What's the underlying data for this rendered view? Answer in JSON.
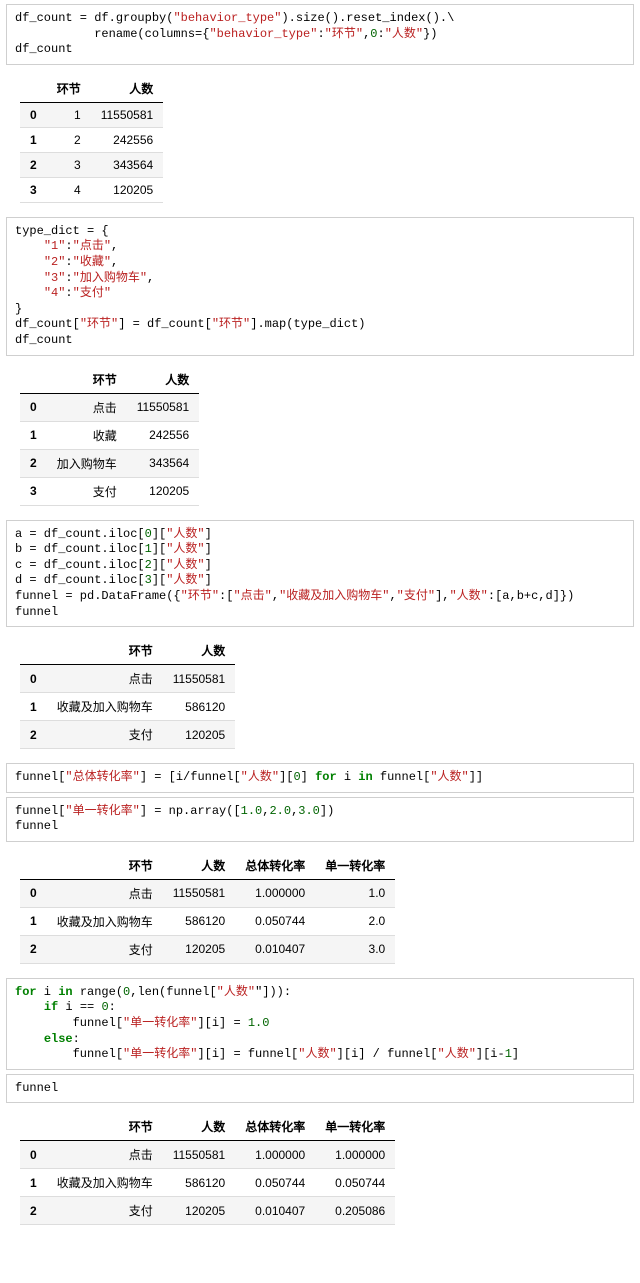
{
  "code1": {
    "l1a": "df_count = df.groupby(",
    "l1s": "\"behavior_type\"",
    "l1b": ").size().reset_index().\\",
    "l2a": "           rename(columns={",
    "l2s1": "\"behavior_type\"",
    "l2b": ":",
    "l2s2": "\"环节\"",
    "l2c": ",",
    "l2n": "0",
    "l2d": ":",
    "l2s3": "\"人数\"",
    "l2e": "})",
    "l3": "df_count"
  },
  "table1": {
    "headers": [
      "",
      "环节",
      "人数"
    ],
    "rows": [
      [
        "0",
        "1",
        "11550581"
      ],
      [
        "1",
        "2",
        "242556"
      ],
      [
        "2",
        "3",
        "343564"
      ],
      [
        "3",
        "4",
        "120205"
      ]
    ]
  },
  "code2": {
    "l1": "type_dict = {",
    "k1": "\"1\"",
    "v1": "\"点击\"",
    "k2": "\"2\"",
    "v2": "\"收藏\"",
    "k3": "\"3\"",
    "v3": "\"加入购物车\"",
    "k4": "\"4\"",
    "v4": "\"支付\"",
    "l6": "}",
    "l7a": "df_count[",
    "l7s1": "\"环节\"",
    "l7b": "] = df_count[",
    "l7s2": "\"环节\"",
    "l7c": "].map(type_dict)",
    "l8": "df_count"
  },
  "table2": {
    "headers": [
      "",
      "环节",
      "人数"
    ],
    "rows": [
      [
        "0",
        "点击",
        "11550581"
      ],
      [
        "1",
        "收藏",
        "242556"
      ],
      [
        "2",
        "加入购物车",
        "343564"
      ],
      [
        "3",
        "支付",
        "120205"
      ]
    ]
  },
  "code3": {
    "l1a": "a = df_count.iloc[",
    "n1": "0",
    "l1b": "][",
    "s1": "\"人数\"",
    "l1c": "]",
    "l2a": "b = df_count.iloc[",
    "n2": "1",
    "l2b": "][",
    "s2": "\"人数\"",
    "l2c": "]",
    "l3a": "c = df_count.iloc[",
    "n3": "2",
    "l3b": "][",
    "s3": "\"人数\"",
    "l3c": "]",
    "l4a": "d = df_count.iloc[",
    "n4": "3",
    "l4b": "][",
    "s4": "\"人数\"",
    "l4c": "]",
    "l5a": "funnel = pd.DataFrame({",
    "s5": "\"环节\"",
    "l5b": ":[",
    "s6": "\"点击\"",
    "l5c": ",",
    "s7": "\"收藏及加入购物车\"",
    "l5d": ",",
    "s8": "\"支付\"",
    "l5e": "],",
    "s9": "\"人数\"",
    "l5f": ":[a,b+c,d]})",
    "l6": "funnel"
  },
  "table3": {
    "headers": [
      "",
      "环节",
      "人数"
    ],
    "rows": [
      [
        "0",
        "点击",
        "11550581"
      ],
      [
        "1",
        "收藏及加入购物车",
        "586120"
      ],
      [
        "2",
        "支付",
        "120205"
      ]
    ]
  },
  "code4": {
    "a": "funnel[",
    "s1": "\"总体转化率\"",
    "b": "] = [i/funnel[",
    "s2": "\"人数\"",
    "c": "][",
    "n1": "0",
    "d": "] ",
    "kw1": "for",
    "e": " i ",
    "kw2": "in",
    "f": " funnel[",
    "s3": "\"人数\"",
    "g": "]]"
  },
  "code5": {
    "a": "funnel[",
    "s1": "\"单一转化率\"",
    "b": "] = np.array([",
    "n1": "1.0",
    "c": ",",
    "n2": "2.0",
    "d": ",",
    "n3": "3.0",
    "e": "])",
    "l2": "funnel"
  },
  "table4": {
    "headers": [
      "",
      "环节",
      "人数",
      "总体转化率",
      "单一转化率"
    ],
    "rows": [
      [
        "0",
        "点击",
        "11550581",
        "1.000000",
        "1.0"
      ],
      [
        "1",
        "收藏及加入购物车",
        "586120",
        "0.050744",
        "2.0"
      ],
      [
        "2",
        "支付",
        "120205",
        "0.010407",
        "3.0"
      ]
    ]
  },
  "code6": {
    "l1a": "",
    "kw1": "for",
    "l1b": " i ",
    "kw2": "in",
    "l1c": " range(",
    "n1": "0",
    "l1d": ",len(funnel[",
    "s1": "\"人数\"",
    "l1e": "]):",
    "l2a": "    ",
    "kw3": "if",
    "l2b": " i == ",
    "n2": "0",
    "l2c": ":",
    "l3a": "        funnel[",
    "s2": "\"单一转化率\"",
    "l3b": "][i] = ",
    "n3": "1.0",
    "l4a": "    ",
    "kw4": "else",
    "l4b": ":",
    "l5a": "        funnel[",
    "s3": "\"单一转化率\"",
    "l5b": "][i] = funnel[",
    "s4": "\"人数\"",
    "l5c": "][i] / funnel[",
    "s5": "\"人数\"",
    "l5d": "][i-",
    "n4": "1",
    "l5e": "]"
  },
  "code7": {
    "l1": "funnel"
  },
  "table5": {
    "headers": [
      "",
      "环节",
      "人数",
      "总体转化率",
      "单一转化率"
    ],
    "rows": [
      [
        "0",
        "点击",
        "11550581",
        "1.000000",
        "1.000000"
      ],
      [
        "1",
        "收藏及加入购物车",
        "586120",
        "0.050744",
        "0.050744"
      ],
      [
        "2",
        "支付",
        "120205",
        "0.010407",
        "0.205086"
      ]
    ]
  }
}
